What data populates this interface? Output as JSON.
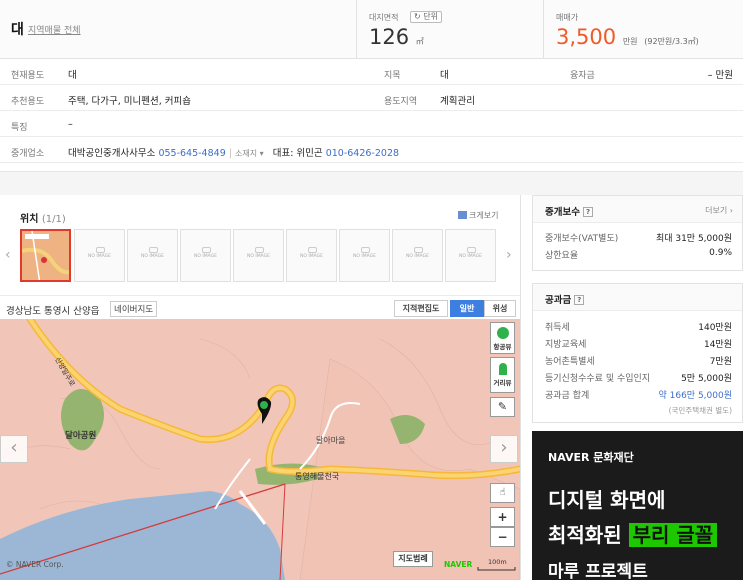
{
  "header": {
    "kind": "대",
    "kind_link": "지역매물 전체",
    "area_label": "대지면적",
    "unit_btn": "단위",
    "area_value": "126",
    "area_unit": "㎡",
    "price_label": "매매가",
    "price_value": "3,500",
    "price_unit": "만원",
    "price_sub": "(92만원/3.3㎡)"
  },
  "info": {
    "current_use_k": "현재용도",
    "current_use_v": "대",
    "category_k": "지목",
    "category_v": "대",
    "loan_k": "융자금",
    "loan_v": "– 만원",
    "recommended_k": "추천용도",
    "recommended_v": "주택, 다가구, 미니펜션, 커피숍",
    "zone_k": "용도지역",
    "zone_v": "계획관리",
    "feature_k": "특징",
    "feature_v": "–",
    "agency_k": "중개업소",
    "agency_name": "대박공인중개사사무소",
    "agency_phone": "055-645-4849",
    "agency_addr": "소재지",
    "rep_label": "대표: 위민곤",
    "rep_phone": "010-6426-2028"
  },
  "location": {
    "title": "위치",
    "count": "(1/1)",
    "zoom_link": "크게보기",
    "no_image": "NO IMAGE",
    "address": "경상남도 통영시 산양읍",
    "naver_map": "네이버지도",
    "maptypes": [
      "지적편집도",
      "일반",
      "위성"
    ],
    "map_labels": {
      "place1": "달아공원",
      "place2": "달아마을",
      "place3": "통영해물천국",
      "road": "산양일주로",
      "copyright": "© NAVER Corp.",
      "legend": "지도범례",
      "naver": "NAVER",
      "scale": "100m"
    },
    "controls": {
      "street": "항공뷰",
      "distance": "거리뷰",
      "plus": "+",
      "minus": "−"
    }
  },
  "commission": {
    "title": "중개보수",
    "more": "더보기 ›",
    "rows": [
      {
        "k": "중개보수(VAT별도)",
        "v": "최대 31만 5,000원"
      },
      {
        "k": "상한요율",
        "v": "0.9%"
      }
    ]
  },
  "tax": {
    "title": "공과금",
    "rows": [
      {
        "k": "취득세",
        "v": "140만원"
      },
      {
        "k": "지방교육세",
        "v": "14만원"
      },
      {
        "k": "농어촌특별세",
        "v": "7만원"
      },
      {
        "k": "등기신청수수료 및 수입인지",
        "v": "5만 5,000원"
      },
      {
        "k": "공과금 합계",
        "v": "약 166만 5,000원"
      }
    ],
    "note": "(국민주택채권 별도)"
  },
  "ad": {
    "brand": "NAVER 문화재단",
    "line1": "디지털 화면에",
    "line2a": "최적화된",
    "line2b": "부리 글꼴",
    "line3": "마루 프로젝트"
  },
  "colors": {
    "price": "#f05a28",
    "link": "#3d6ec9",
    "accent": "#3d7fe0"
  }
}
